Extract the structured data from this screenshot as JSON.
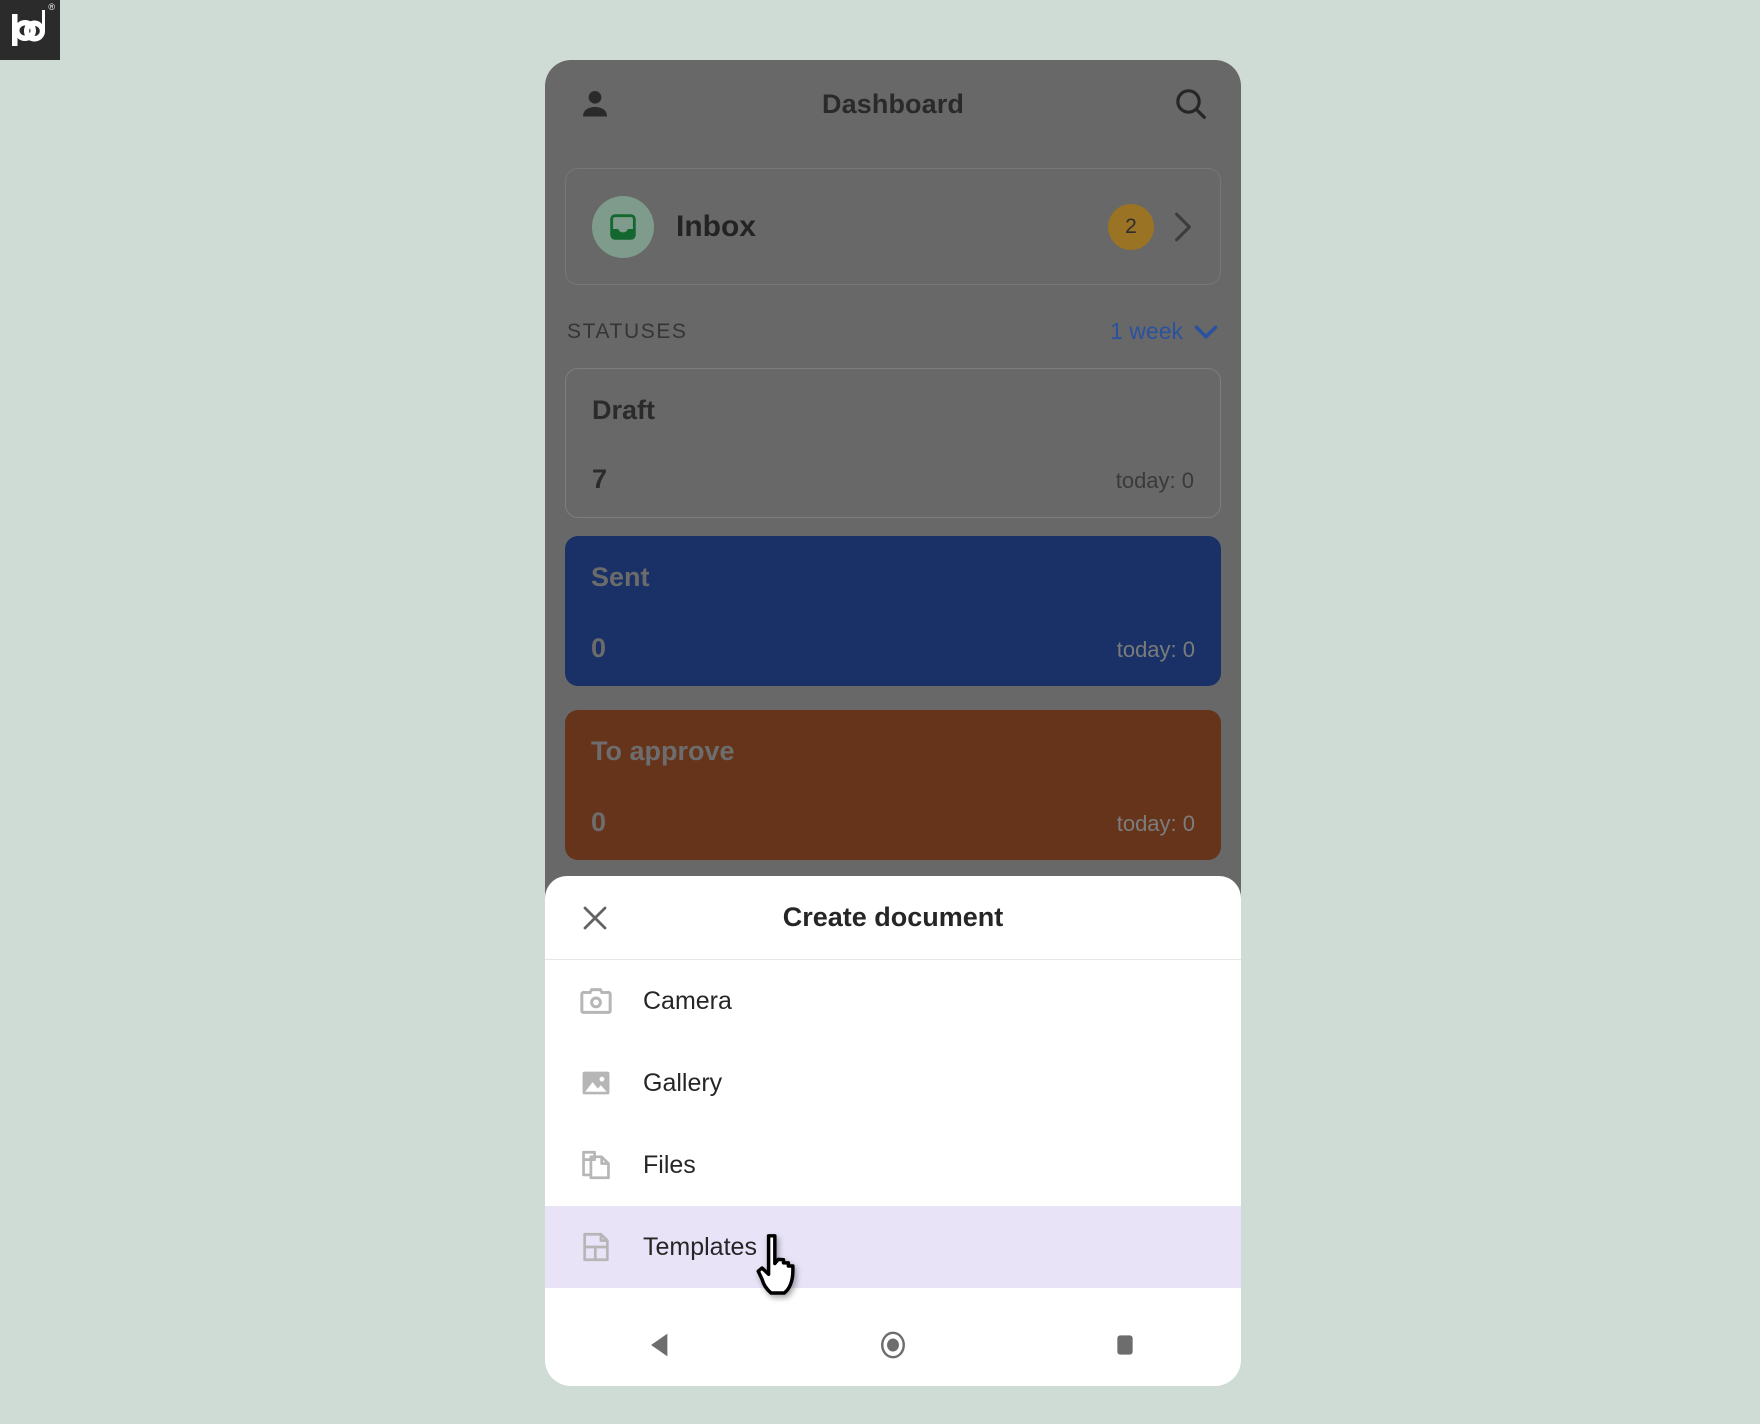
{
  "brand": {
    "logo_text": "pd",
    "registered_mark": "®"
  },
  "app_bar": {
    "title": "Dashboard",
    "profile_icon": "person-icon",
    "search_icon": "search-icon"
  },
  "inbox": {
    "label": "Inbox",
    "badge_count": "2",
    "icon": "inbox-tray-icon",
    "chevron_icon": "chevron-right-icon",
    "badge_color": "#9a7324",
    "avatar_color": "#7f9b8c"
  },
  "statuses": {
    "section_title": "STATUSES",
    "period_label": "1 week",
    "period_caret_icon": "chevron-down-icon",
    "period_color": "#2a52a0",
    "cards": [
      {
        "name": "Draft",
        "count": "7",
        "today": "today: 0",
        "color": "transparent"
      },
      {
        "name": "Sent",
        "count": "0",
        "today": "today: 0",
        "color": "#1a3168"
      },
      {
        "name": "To approve",
        "count": "0",
        "today": "today: 0",
        "color": "#66341b"
      }
    ]
  },
  "create_sheet": {
    "title": "Create document",
    "close_icon": "close-icon",
    "items": [
      {
        "label": "Camera",
        "icon": "camera-icon",
        "highlighted": false
      },
      {
        "label": "Gallery",
        "icon": "image-icon",
        "highlighted": false
      },
      {
        "label": "Files",
        "icon": "files-icon",
        "highlighted": false
      },
      {
        "label": "Templates",
        "icon": "template-icon",
        "highlighted": true
      }
    ],
    "highlight_color": "#e8e3f7"
  },
  "android_nav": {
    "back_icon": "back-triangle-icon",
    "home_icon": "home-circle-icon",
    "recents_icon": "recents-square-icon"
  },
  "cursor": {
    "icon": "pointing-hand-cursor"
  },
  "page_background": "#cedcd5"
}
